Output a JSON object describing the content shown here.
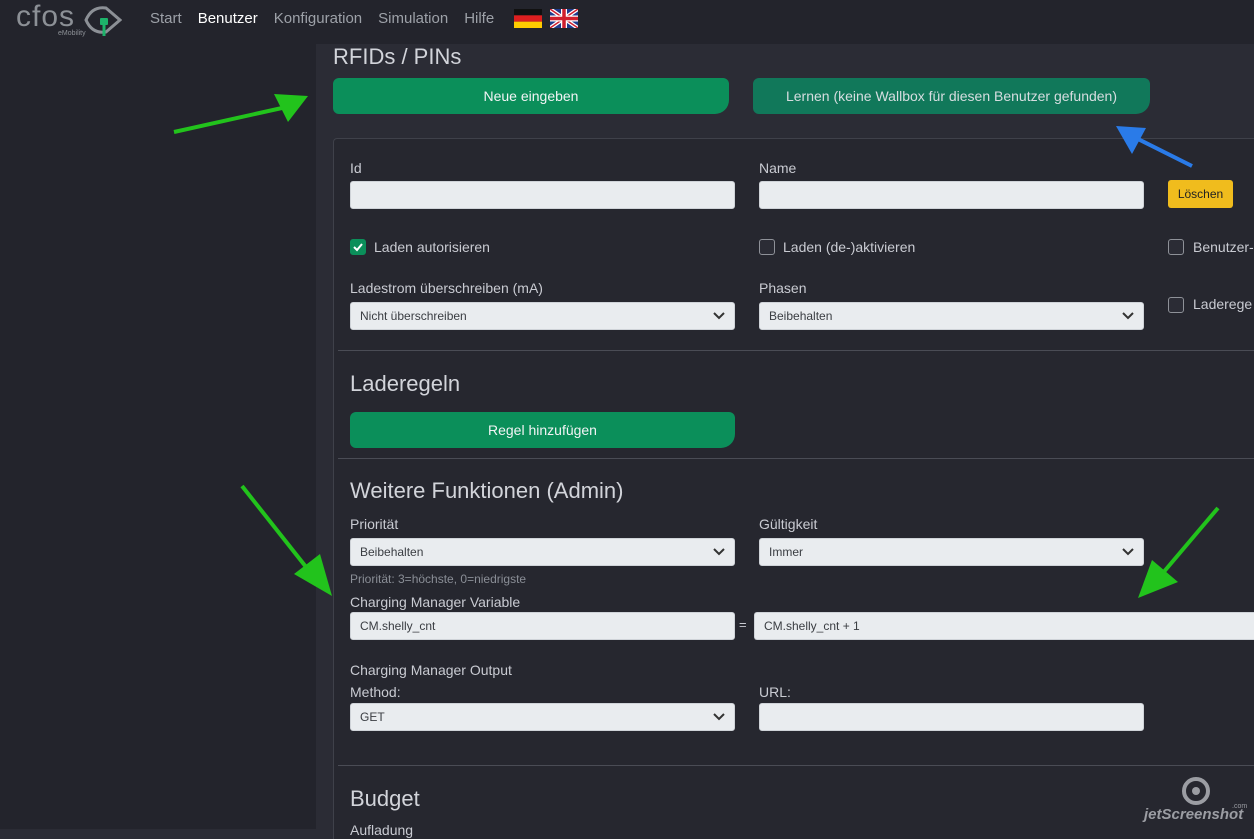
{
  "app": {
    "logo_text": "cfos",
    "logo_sub": "eMobility"
  },
  "nav": [
    {
      "label": "Start",
      "active": false
    },
    {
      "label": "Benutzer",
      "active": true
    },
    {
      "label": "Konfiguration",
      "active": false
    },
    {
      "label": "Simulation",
      "active": false
    },
    {
      "label": "Hilfe",
      "active": false
    }
  ],
  "languages": [
    "flag-de-icon",
    "flag-uk-icon"
  ],
  "page": {
    "title": "RFIDs / PINs",
    "new_button": "Neue eingeben",
    "learn_button": "Lernen (keine Wallbox für diesen Benutzer gefunden)"
  },
  "form": {
    "id_label": "Id",
    "id_value": "",
    "name_label": "Name",
    "name_value": "",
    "delete_button": "Löschen",
    "charge_authorize_label": "Laden autorisieren",
    "charge_authorize_checked": true,
    "charge_toggle_label": "Laden (de-)aktivieren",
    "charge_toggle_checked": false,
    "user_label": "Benutzer-",
    "user_checked": false,
    "current_label": "Ladestrom überschreiben (mA)",
    "current_value": "Nicht überschreiben",
    "phases_label": "Phasen",
    "phases_value": "Beibehalten",
    "rules_check_label": "Laderege",
    "rules_check_checked": false
  },
  "rules": {
    "title": "Laderegeln",
    "add_button": "Regel hinzufügen"
  },
  "admin": {
    "title": "Weitere Funktionen (Admin)",
    "priority_label": "Priorität",
    "priority_value": "Beibehalten",
    "priority_hint": "Priorität: 3=höchste, 0=niedrigste",
    "validity_label": "Gültigkeit",
    "validity_value": "Immer",
    "cm_var_label": "Charging Manager Variable",
    "cm_var_name": "CM.shelly_cnt",
    "equals": "=",
    "cm_var_expr": "CM.shelly_cnt + 1",
    "cm_output_label": "Charging Manager Output",
    "method_label": "Method:",
    "method_value": "GET",
    "url_label": "URL:",
    "url_value": ""
  },
  "budget": {
    "title": "Budget",
    "sub_label": "Aufladung"
  },
  "watermark": {
    "text": "jetScreenshot",
    "com": ".com"
  },
  "colors": {
    "accent_green": "#0b8f5a",
    "warning_yellow": "#f0bc1d",
    "arrow_green": "#22c31c",
    "arrow_blue": "#2a7be8"
  }
}
